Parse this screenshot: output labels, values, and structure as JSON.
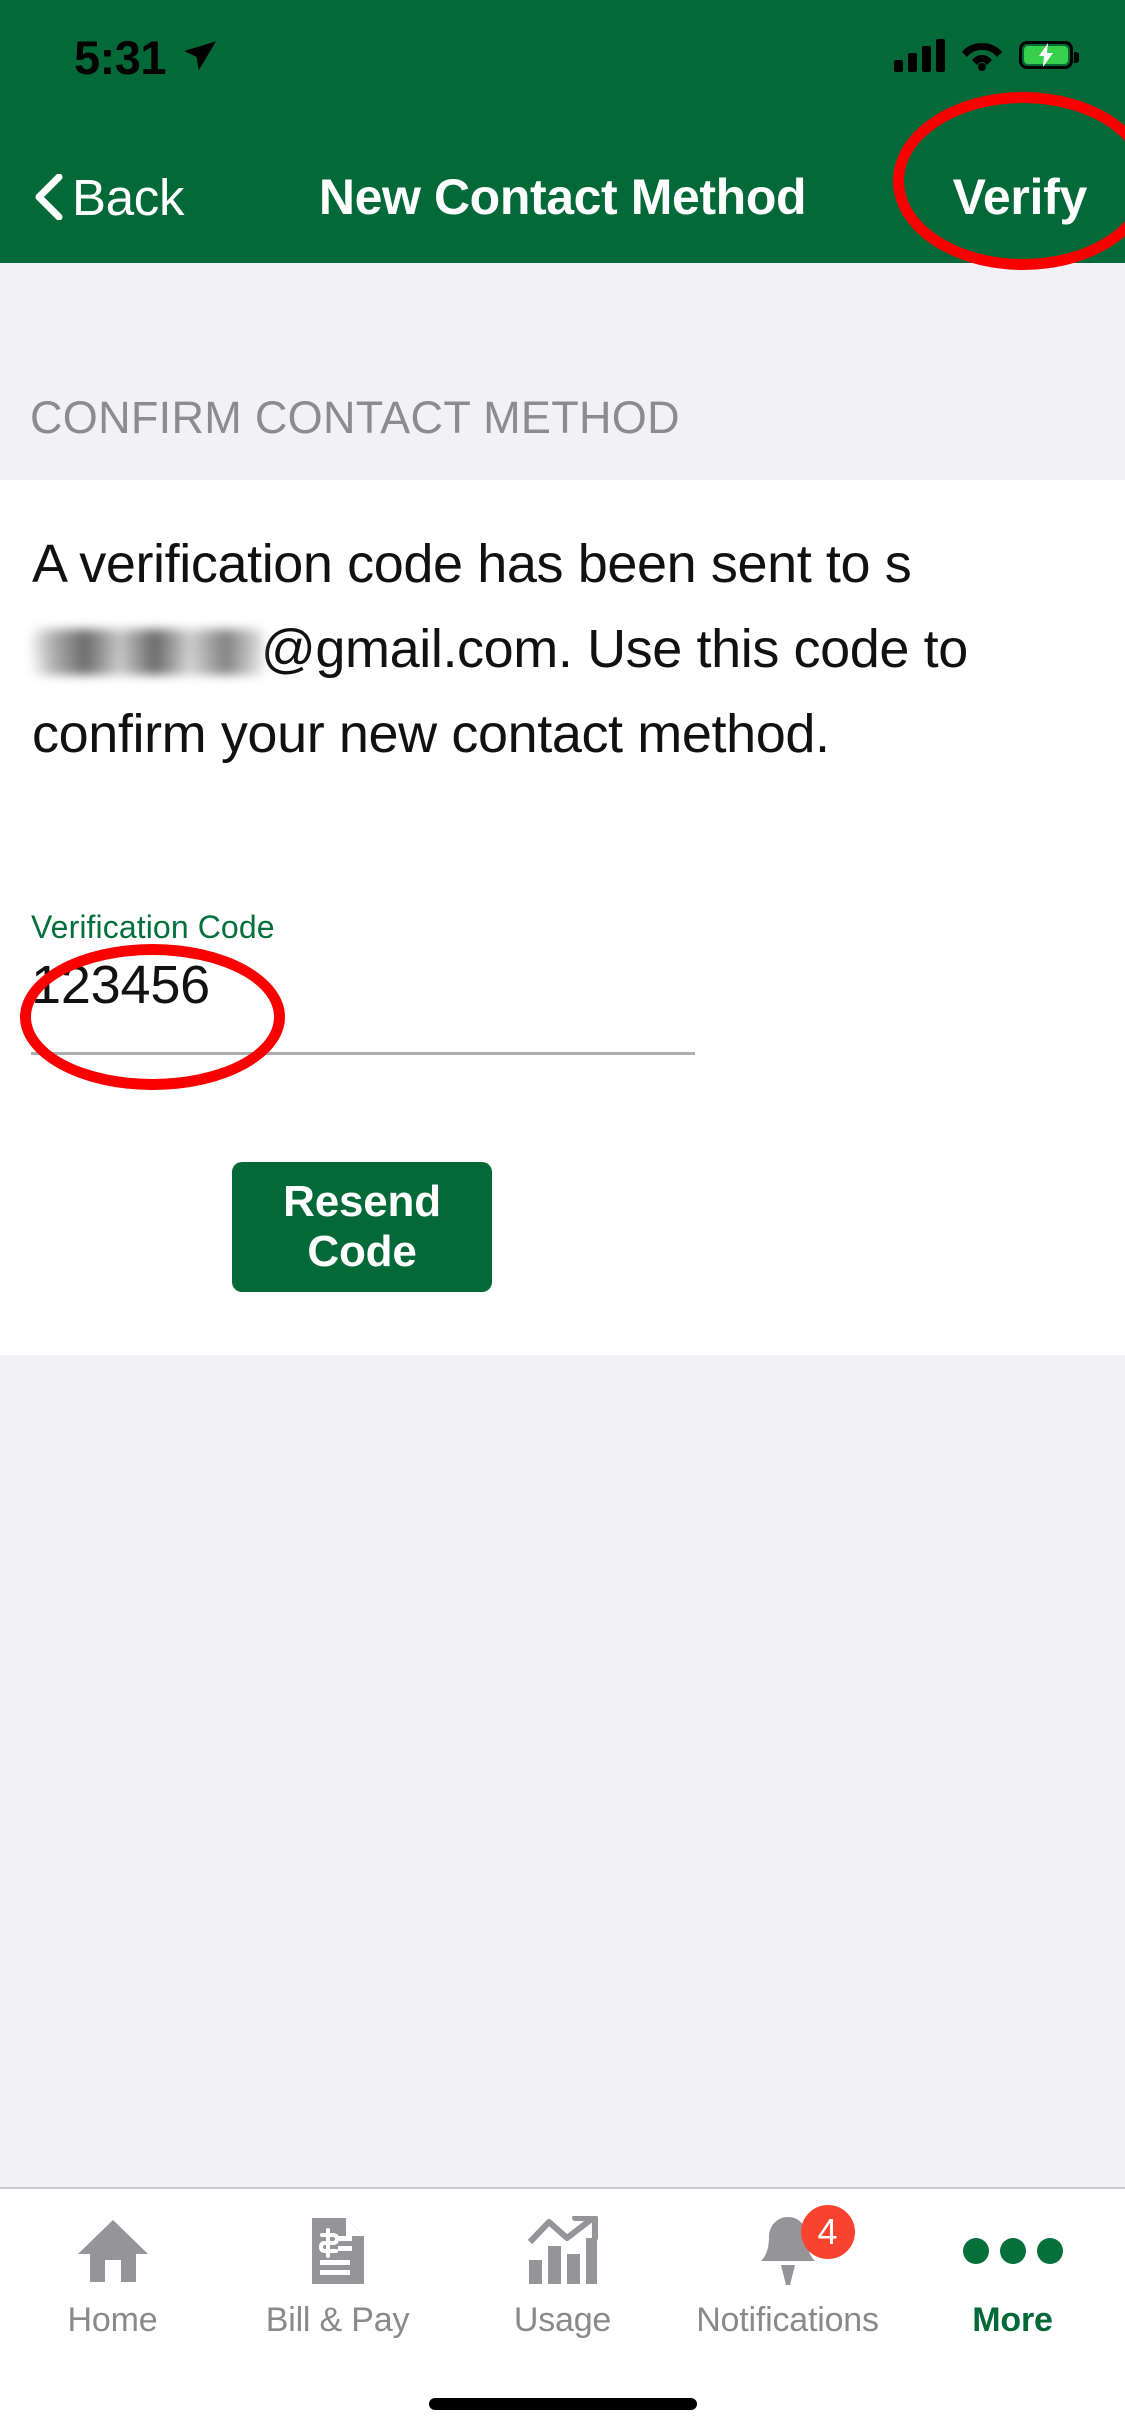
{
  "status_bar": {
    "time": "5:31",
    "location_icon": "location-arrow-icon",
    "signal_icon": "cellular-signal-icon",
    "wifi_icon": "wifi-icon",
    "battery_icon": "battery-charging-icon"
  },
  "nav": {
    "back_label": "Back",
    "back_icon": "chevron-left-icon",
    "title": "New Contact Method",
    "action_label": "Verify"
  },
  "section": {
    "header": "CONFIRM CONTACT METHOD"
  },
  "body": {
    "text_before": "A verification code has been sent to s",
    "redacted_email": "",
    "text_after": "@gmail.com. Use this code to confirm your new contact method."
  },
  "form": {
    "field_label": "Verification Code",
    "field_value": "123456",
    "field_placeholder": "Verification Code",
    "resend_label": "Resend Code"
  },
  "tabs": [
    {
      "label": "Home",
      "icon": "home-icon",
      "active": false,
      "badge": ""
    },
    {
      "label": "Bill & Pay",
      "icon": "bill-document-icon",
      "active": false,
      "badge": ""
    },
    {
      "label": "Usage",
      "icon": "usage-chart-icon",
      "active": false,
      "badge": ""
    },
    {
      "label": "Notifications",
      "icon": "bell-icon",
      "active": false,
      "badge": "4"
    },
    {
      "label": "More",
      "icon": "ellipsis-icon",
      "active": true,
      "badge": ""
    }
  ],
  "colors": {
    "brand_green": "#046938",
    "label_green": "#06703c",
    "page_grey": "#f1f1f6",
    "badge_red": "#f8432e",
    "annotation_red": "#fa0000",
    "muted_text": "#8a8a8e"
  }
}
